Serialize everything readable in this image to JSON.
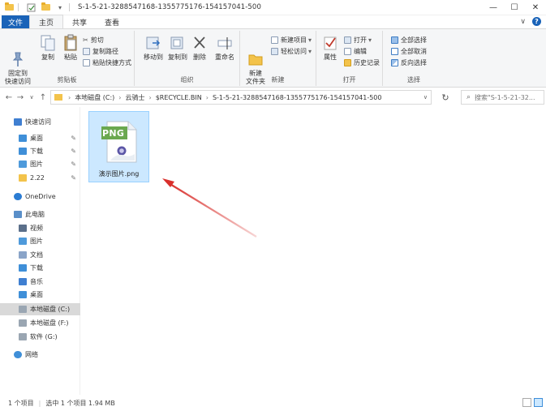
{
  "window": {
    "title": "S-1-5-21-3288547168-1355775176-154157041-500",
    "controls": [
      "minimize",
      "maximize",
      "close"
    ]
  },
  "ribbon_tabs": {
    "file": "文件",
    "items": [
      "主页",
      "共享",
      "查看"
    ],
    "active": "主页"
  },
  "ribbon": {
    "clipboard": {
      "label": "剪贴板",
      "pin_quick": "固定到\n快速访问",
      "copy": "复制",
      "paste": "粘贴",
      "cut": "剪切",
      "copy_path": "复制路径",
      "paste_shortcut": "粘贴快捷方式"
    },
    "organize": {
      "label": "组织",
      "move_to": "移动到",
      "copy_to": "复制到",
      "delete": "删除",
      "rename": "重命名"
    },
    "new": {
      "label": "新建",
      "new_folder": "新建\n文件夹",
      "new_item": "新建项目",
      "easy_access": "轻松访问"
    },
    "open": {
      "label": "打开",
      "properties": "属性",
      "open": "打开",
      "edit": "编辑",
      "history": "历史记录"
    },
    "select": {
      "label": "选择",
      "select_all": "全部选择",
      "select_none": "全部取消",
      "invert": "反向选择"
    }
  },
  "address": {
    "crumbs": [
      "本地磁盘 (C:)",
      "云骑士",
      "$RECYCLE.BIN",
      "S-1-5-21-3288547168-1355775176-154157041-500"
    ],
    "search_placeholder": "搜索\"S-1-5-21-32..."
  },
  "sidebar": {
    "items": [
      {
        "label": "快速访问",
        "icon": "star-icon",
        "level": 0,
        "pinned": false
      },
      {
        "label": "桌面",
        "icon": "desktop-icon",
        "level": 1,
        "pinned": true
      },
      {
        "label": "下载",
        "icon": "download-icon",
        "level": 1,
        "pinned": true
      },
      {
        "label": "图片",
        "icon": "pictures-icon",
        "level": 1,
        "pinned": true
      },
      {
        "label": "2.22",
        "icon": "folder-icon",
        "level": 1,
        "pinned": true
      },
      {
        "label": "OneDrive",
        "icon": "cloud-icon",
        "level": 0,
        "pinned": false
      },
      {
        "label": "此电脑",
        "icon": "computer-icon",
        "level": 0,
        "pinned": false
      },
      {
        "label": "视频",
        "icon": "video-icon",
        "level": 1,
        "pinned": false
      },
      {
        "label": "图片",
        "icon": "pictures-icon",
        "level": 1,
        "pinned": false
      },
      {
        "label": "文档",
        "icon": "documents-icon",
        "level": 1,
        "pinned": false
      },
      {
        "label": "下载",
        "icon": "download-icon",
        "level": 1,
        "pinned": false
      },
      {
        "label": "音乐",
        "icon": "music-icon",
        "level": 1,
        "pinned": false
      },
      {
        "label": "桌面",
        "icon": "desktop-icon",
        "level": 1,
        "pinned": false
      },
      {
        "label": "本地磁盘 (C:)",
        "icon": "drive-icon",
        "level": 1,
        "pinned": false,
        "selected": true
      },
      {
        "label": "本地磁盘 (F:)",
        "icon": "drive-icon",
        "level": 1,
        "pinned": false
      },
      {
        "label": "软件 (G:)",
        "icon": "drive-icon",
        "level": 1,
        "pinned": false
      },
      {
        "label": "网络",
        "icon": "network-icon",
        "level": 0,
        "pinned": false
      }
    ]
  },
  "file": {
    "name": "演示图片.png",
    "type_badge": "PNG"
  },
  "status": {
    "count": "1 个项目",
    "selected": "选中 1 个项目  1.94 MB"
  },
  "colors": {
    "accent": "#1a63b8",
    "selection_bg": "#cce8ff",
    "selection_border": "#99d1ff",
    "arrow": "#d9302c",
    "png_green": "#6aa84f"
  }
}
